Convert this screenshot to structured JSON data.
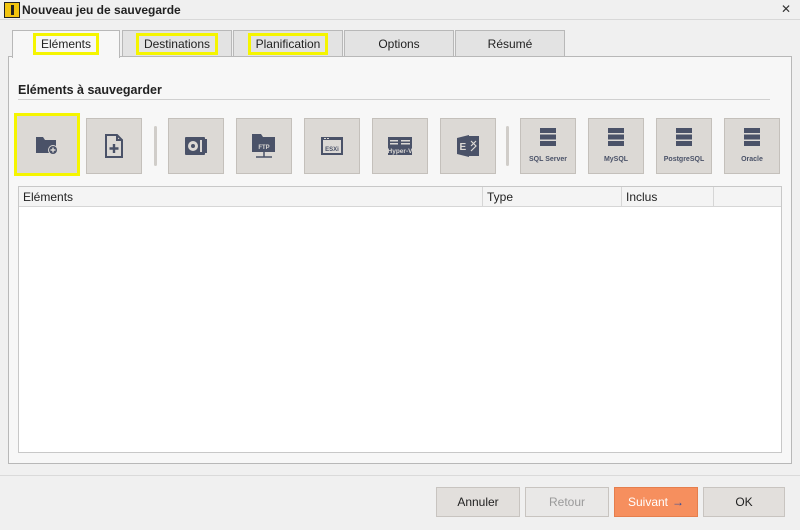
{
  "window": {
    "title": "Nouveau jeu de sauvegarde",
    "close_glyph": "✕"
  },
  "tabs": [
    {
      "label": "Eléments",
      "active": true
    },
    {
      "label": "Destinations"
    },
    {
      "label": "Planification"
    },
    {
      "label": "Options"
    },
    {
      "label": "Résumé"
    }
  ],
  "section": {
    "title": "Eléments à sauvegarder"
  },
  "toolbar": {
    "icon_color": "#4a5268",
    "items": [
      {
        "icon": "folder-add-icon"
      },
      {
        "icon": "file-add-icon"
      },
      {
        "icon": "disk-image-icon"
      },
      {
        "icon": "ftp-icon",
        "label": "FTP"
      },
      {
        "icon": "esxi-icon",
        "label": "ESXi"
      },
      {
        "icon": "hyper-v-icon",
        "label": "Hyper-V"
      },
      {
        "icon": "exchange-icon"
      },
      {
        "icon": "database-icon",
        "label": "SQL Server"
      },
      {
        "icon": "database-icon",
        "label": "MySQL"
      },
      {
        "icon": "database-icon",
        "label": "PostgreSQL"
      },
      {
        "icon": "database-icon",
        "label": "Oracle"
      }
    ]
  },
  "list": {
    "columns": [
      "Eléments",
      "Type",
      "Inclus"
    ],
    "rows": []
  },
  "buttons": {
    "cancel": "Annuler",
    "back": "Retour",
    "next": "Suivant",
    "next_arrow": "→",
    "ok": "OK"
  },
  "colors": {
    "accent": "#f68f5e",
    "highlight": "#f5f500"
  }
}
